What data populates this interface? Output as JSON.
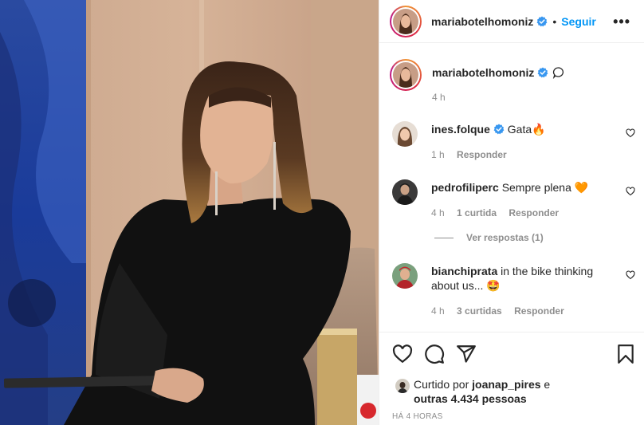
{
  "post": {
    "author": "mariabotelhomoniz",
    "follow_label": "Seguir",
    "more_label": "•••",
    "caption_time": "4 h",
    "posted_ago": "HÁ 4 HORAS"
  },
  "comments": [
    {
      "user": "ines.folque",
      "text": "Gata🔥",
      "time": "1 h",
      "likes": "",
      "reply_label": "Responder"
    },
    {
      "user": "pedrofiliperc",
      "text": "Sempre plena 🧡",
      "time": "4 h",
      "likes": "1 curtida",
      "reply_label": "Responder"
    },
    {
      "user": "bianchiprata",
      "text": "in the bike thinking about us... 🤩",
      "time": "4 h",
      "likes": "3 curtidas",
      "reply_label": "Responder"
    }
  ],
  "view_replies_label": "Ver respostas (1)",
  "likes": {
    "prefix": "Curtido por",
    "user": "joanap_pires",
    "joiner": "e",
    "others": "outras 4.434 pessoas"
  },
  "colors": {
    "accent": "#0095f6",
    "muted": "#8e8e8e",
    "verified": "#3897f0",
    "text": "#262626"
  }
}
